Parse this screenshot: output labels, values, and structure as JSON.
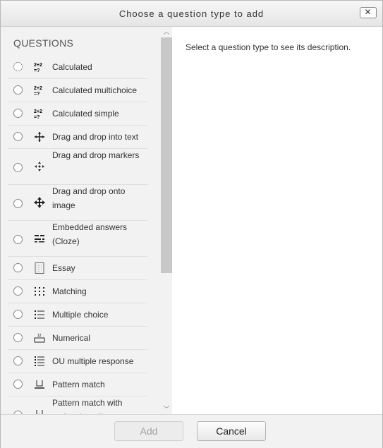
{
  "dialog": {
    "title": "Choose a question type to add",
    "close_label": "✕"
  },
  "options": {
    "section_header": "QUESTIONS",
    "items": [
      {
        "label": "Calculated",
        "icon": "calculated-icon",
        "glyph": "2+2\n=?"
      },
      {
        "label": "Calculated multichoice",
        "icon": "calculated-multichoice-icon",
        "glyph": "2+2\n=?"
      },
      {
        "label": "Calculated simple",
        "icon": "calculated-simple-icon",
        "glyph": "2+2\n=?"
      },
      {
        "label": "Drag and drop into text",
        "icon": "drag-drop-text-icon",
        "glyph": "✥"
      },
      {
        "label": "Drag and drop markers",
        "icon": "drag-drop-markers-icon",
        "glyph": "✥"
      },
      {
        "label": "Drag and drop onto image",
        "icon": "drag-drop-image-icon",
        "glyph": "✥"
      },
      {
        "label": "Embedded answers (Cloze)",
        "icon": "cloze-icon",
        "glyph": "☷"
      },
      {
        "label": "Essay",
        "icon": "essay-icon",
        "glyph": "▤"
      },
      {
        "label": "Matching",
        "icon": "matching-icon",
        "glyph": "⁝⁝⁝"
      },
      {
        "label": "Multiple choice",
        "icon": "multiple-choice-icon",
        "glyph": "☰"
      },
      {
        "label": "Numerical",
        "icon": "numerical-icon",
        "glyph": "⊟"
      },
      {
        "label": "OU multiple response",
        "icon": "multiple-response-icon",
        "glyph": "☰"
      },
      {
        "label": "Pattern match",
        "icon": "pattern-match-icon",
        "glyph": "⌴"
      },
      {
        "label": "Pattern match with molecular editor",
        "icon": "pattern-match-molecular-icon",
        "glyph": "⌇"
      }
    ]
  },
  "description": {
    "text": "Select a question type to see its description."
  },
  "footer": {
    "add_label": "Add",
    "cancel_label": "Cancel"
  }
}
